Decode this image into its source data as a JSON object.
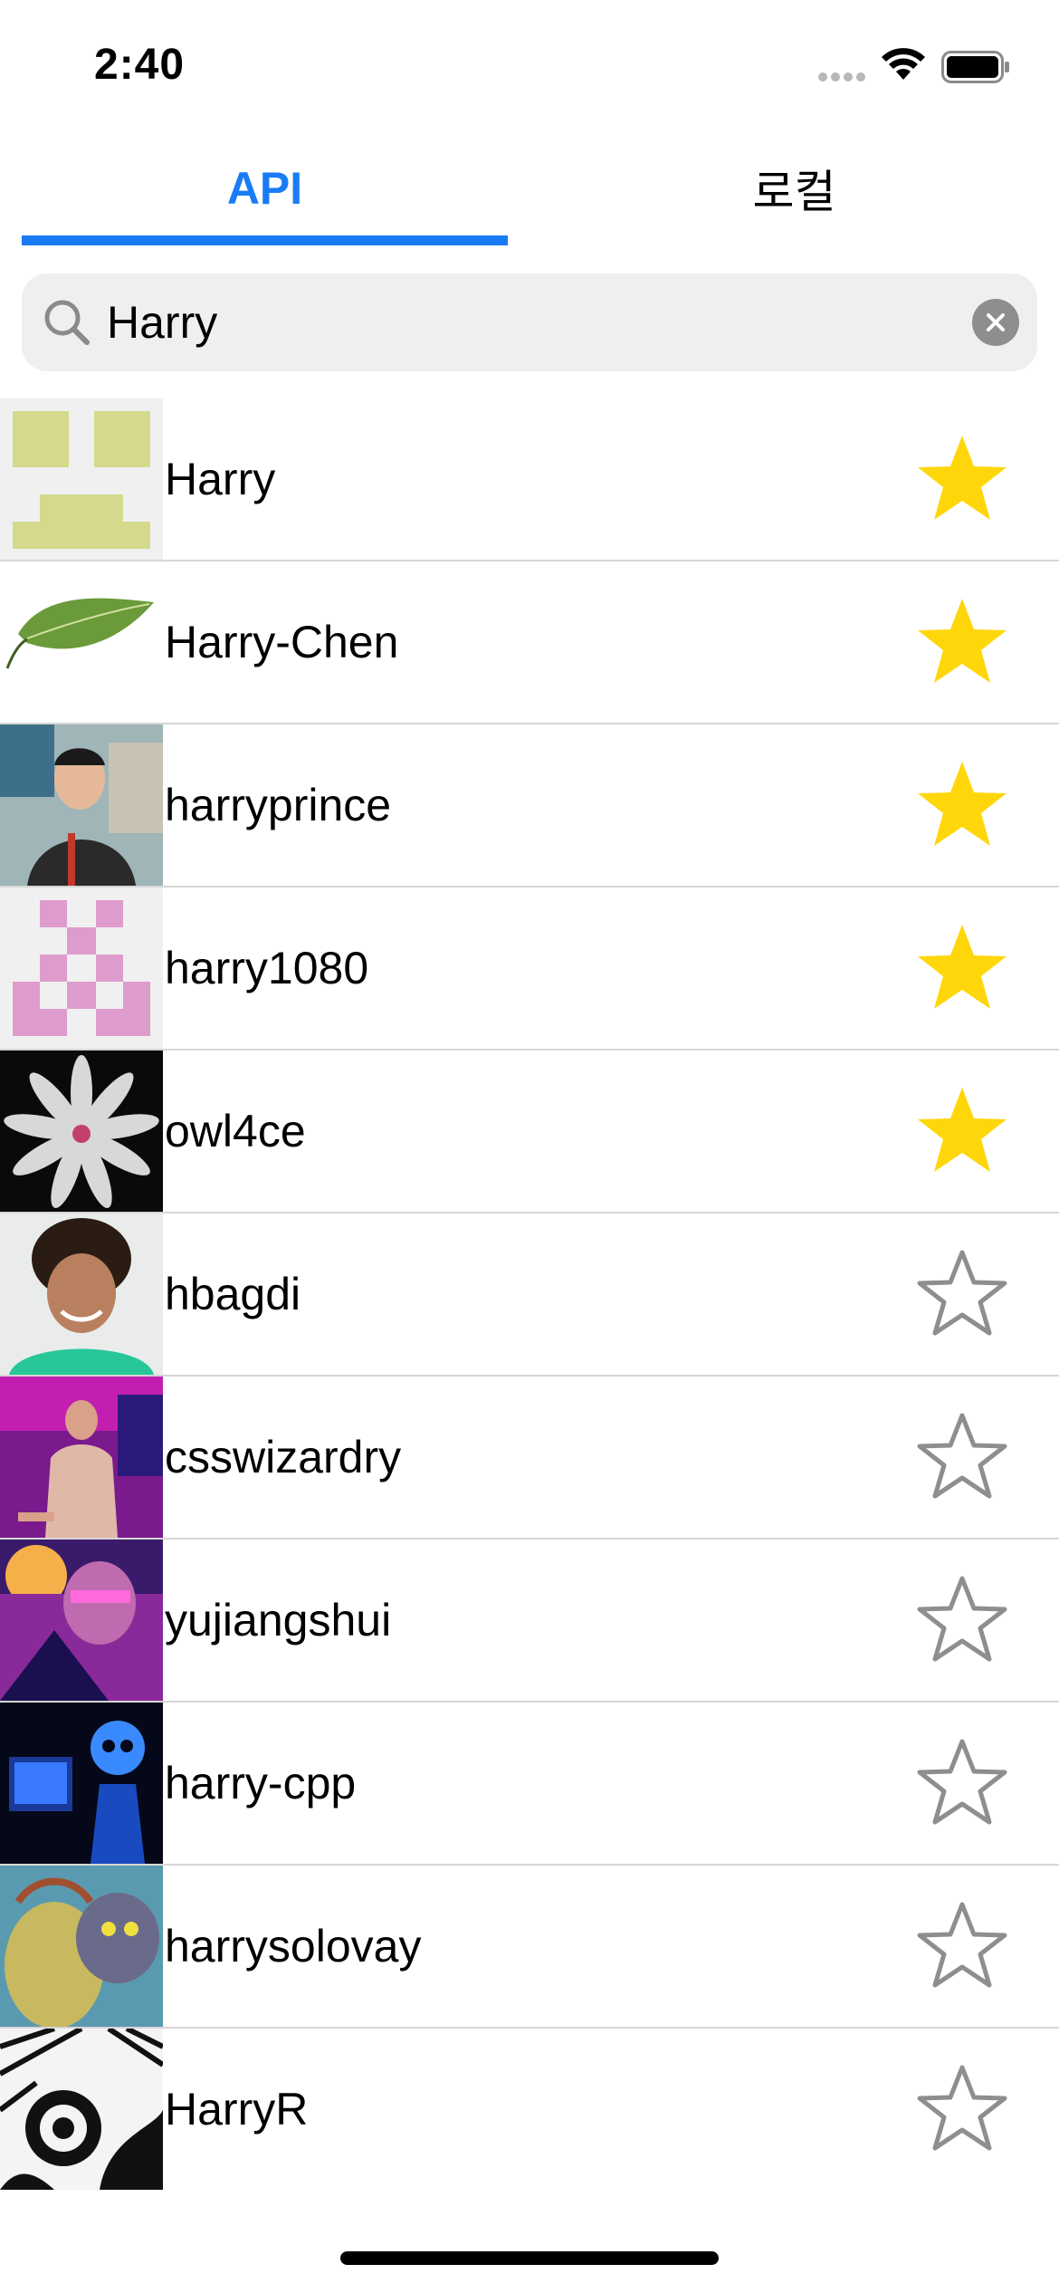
{
  "status_bar": {
    "time": "2:40",
    "icons": [
      "cellular-signal-icon",
      "wifi-icon",
      "battery-icon"
    ]
  },
  "tabs": [
    {
      "label": "API",
      "selected": true
    },
    {
      "label": "로컬",
      "selected": false
    }
  ],
  "colors": {
    "accent": "#1a7cf5",
    "favorite_star": "#ffd60a",
    "empty_star": "#8e8e8e"
  },
  "search": {
    "value": "Harry",
    "icon": "search-icon",
    "clear_icon": "clear-icon"
  },
  "users": [
    {
      "name": "Harry",
      "favorite": true
    },
    {
      "name": "Harry-Chen",
      "favorite": true
    },
    {
      "name": "harryprince",
      "favorite": true
    },
    {
      "name": "harry1080",
      "favorite": true
    },
    {
      "name": "owl4ce",
      "favorite": true
    },
    {
      "name": "hbagdi",
      "favorite": false
    },
    {
      "name": "csswizardry",
      "favorite": false
    },
    {
      "name": "yujiangshui",
      "favorite": false
    },
    {
      "name": "harry-cpp",
      "favorite": false
    },
    {
      "name": "harrysolovay",
      "favorite": false
    },
    {
      "name": "HarryR",
      "favorite": false
    }
  ]
}
